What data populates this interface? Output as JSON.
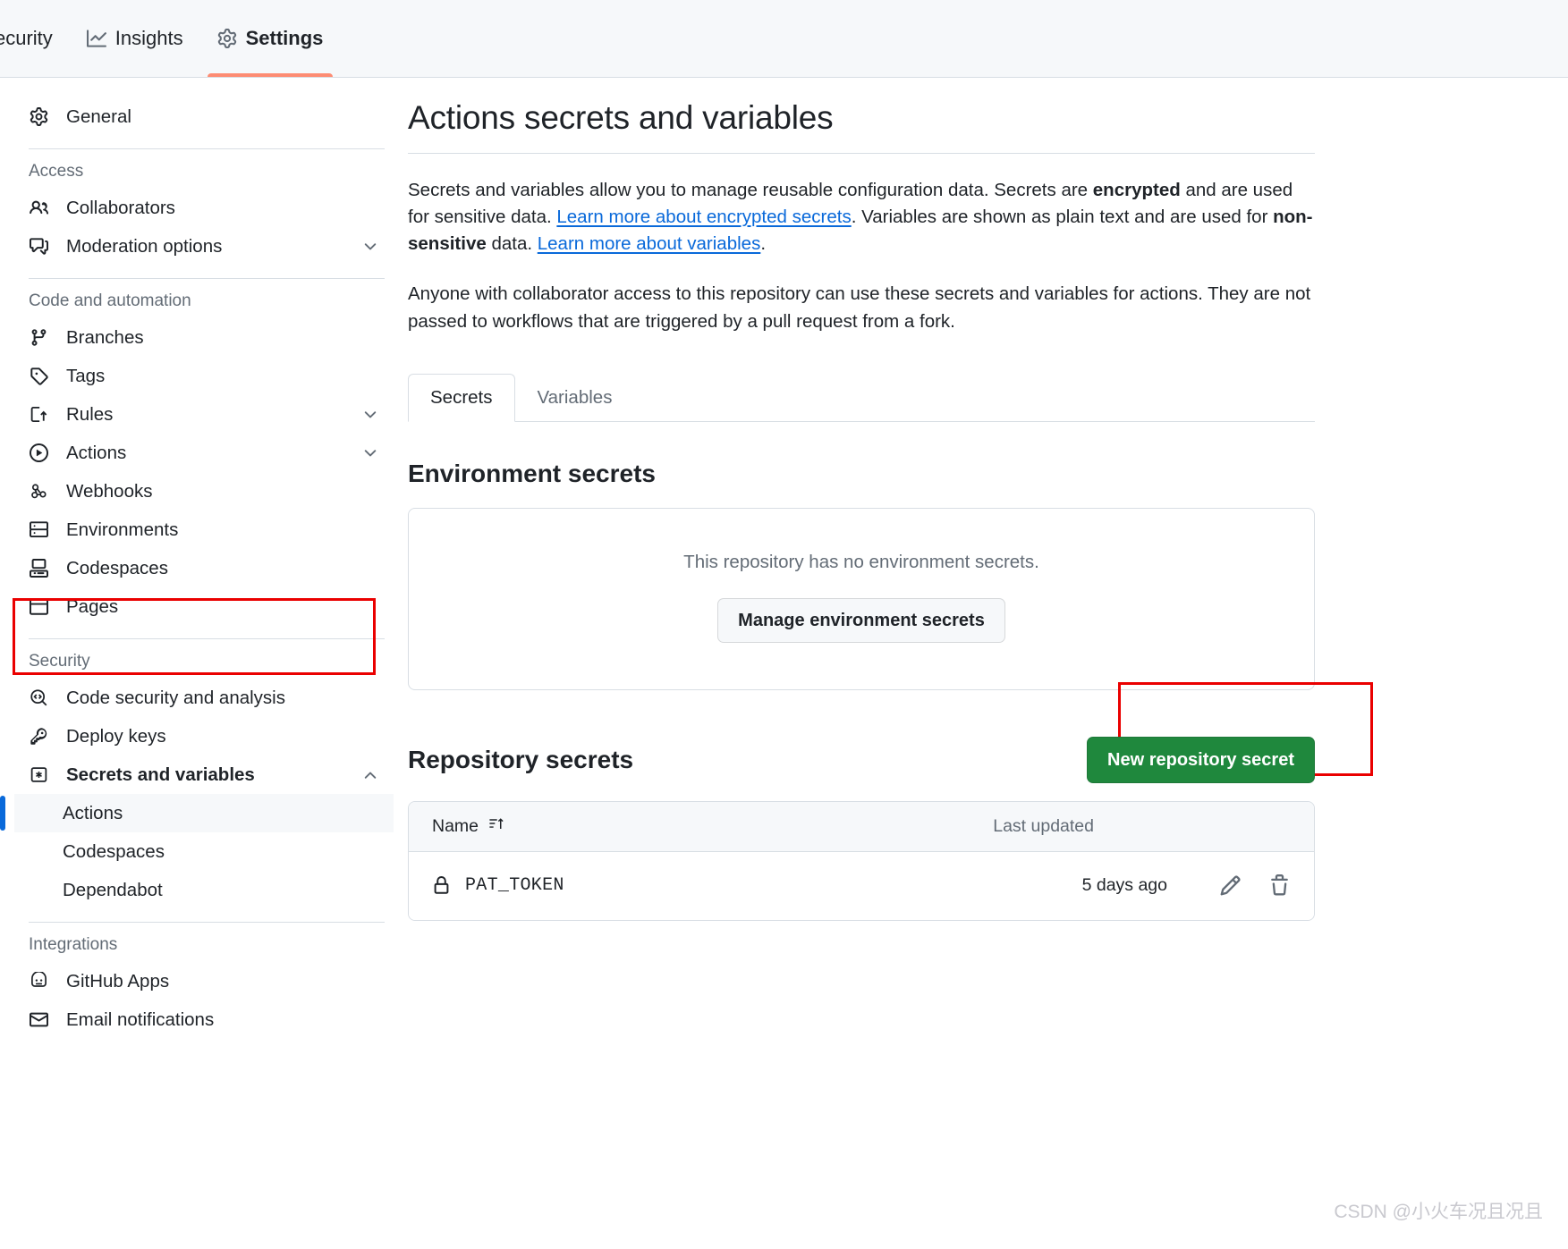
{
  "topnav": {
    "items": [
      {
        "label": "ecurity",
        "icon": "shield-icon",
        "active": false
      },
      {
        "label": "Insights",
        "icon": "graph-icon",
        "active": false
      },
      {
        "label": "Settings",
        "icon": "gear-icon",
        "active": true
      }
    ],
    "accent_color": "#fd8c73"
  },
  "sidebar": {
    "general": {
      "label": "General",
      "icon": "gear-icon"
    },
    "groups": [
      {
        "title": "Access",
        "items": [
          {
            "label": "Collaborators",
            "icon": "people-icon",
            "chevron": false
          },
          {
            "label": "Moderation options",
            "icon": "comment-discussion-icon",
            "chevron": true
          }
        ]
      },
      {
        "title": "Code and automation",
        "items": [
          {
            "label": "Branches",
            "icon": "git-branch-icon",
            "chevron": false
          },
          {
            "label": "Tags",
            "icon": "tag-icon",
            "chevron": false
          },
          {
            "label": "Rules",
            "icon": "rules-icon",
            "chevron": true
          },
          {
            "label": "Actions",
            "icon": "play-icon",
            "chevron": true
          },
          {
            "label": "Webhooks",
            "icon": "webhook-icon",
            "chevron": false
          },
          {
            "label": "Environments",
            "icon": "server-icon",
            "chevron": false
          },
          {
            "label": "Codespaces",
            "icon": "codespaces-icon",
            "chevron": false
          },
          {
            "label": "Pages",
            "icon": "browser-icon",
            "chevron": false
          }
        ]
      },
      {
        "title": "Security",
        "items": [
          {
            "label": "Code security and analysis",
            "icon": "codescan-icon",
            "chevron": false
          },
          {
            "label": "Deploy keys",
            "icon": "key-icon",
            "chevron": false
          },
          {
            "label": "Secrets and variables",
            "icon": "asterisk-key-icon",
            "chevron": true,
            "expanded": true,
            "bold": true
          }
        ],
        "subitems": [
          {
            "label": "Actions",
            "selected": true
          },
          {
            "label": "Codespaces",
            "selected": false
          },
          {
            "label": "Dependabot",
            "selected": false
          }
        ]
      },
      {
        "title": "Integrations",
        "items": [
          {
            "label": "GitHub Apps",
            "icon": "apps-icon",
            "chevron": false
          },
          {
            "label": "Email notifications",
            "icon": "mail-icon",
            "chevron": false
          }
        ]
      }
    ],
    "selection_indicator_color": "#0969da"
  },
  "main": {
    "title": "Actions secrets and variables",
    "paragraph1": {
      "t1": "Secrets and variables allow you to manage reusable configuration data. Secrets are ",
      "b1": "encrypted",
      "t2": " and are used for sensitive data. ",
      "link1": "Learn more about encrypted secrets",
      "t3": ". Variables are shown as plain text and are used for ",
      "b2": "non-sensitive",
      "t4": " data. ",
      "link2": "Learn more about variables",
      "t5": "."
    },
    "paragraph2": "Anyone with collaborator access to this repository can use these secrets and variables for actions. They are not passed to workflows that are triggered by a pull request from a fork.",
    "tabs": [
      {
        "label": "Secrets",
        "active": true
      },
      {
        "label": "Variables",
        "active": false
      }
    ],
    "environment_secrets": {
      "heading": "Environment secrets",
      "empty_text": "This repository has no environment secrets.",
      "manage_button": "Manage environment secrets"
    },
    "repository_secrets": {
      "heading": "Repository secrets",
      "new_button": "New repository secret",
      "new_button_color": "#1f883d",
      "columns": {
        "name": "Name",
        "last_updated": "Last updated"
      },
      "rows": [
        {
          "name": "PAT_TOKEN",
          "last_updated": "5 days ago",
          "icon": "lock-icon",
          "actions": [
            "pencil-icon",
            "trash-icon"
          ]
        }
      ]
    }
  },
  "annotations": {
    "highlight_color": "#ea0000",
    "boxes": [
      "sidebar-secrets-and-variables",
      "new-repository-secret-button"
    ]
  },
  "watermark": "CSDN @小火车况且况且"
}
